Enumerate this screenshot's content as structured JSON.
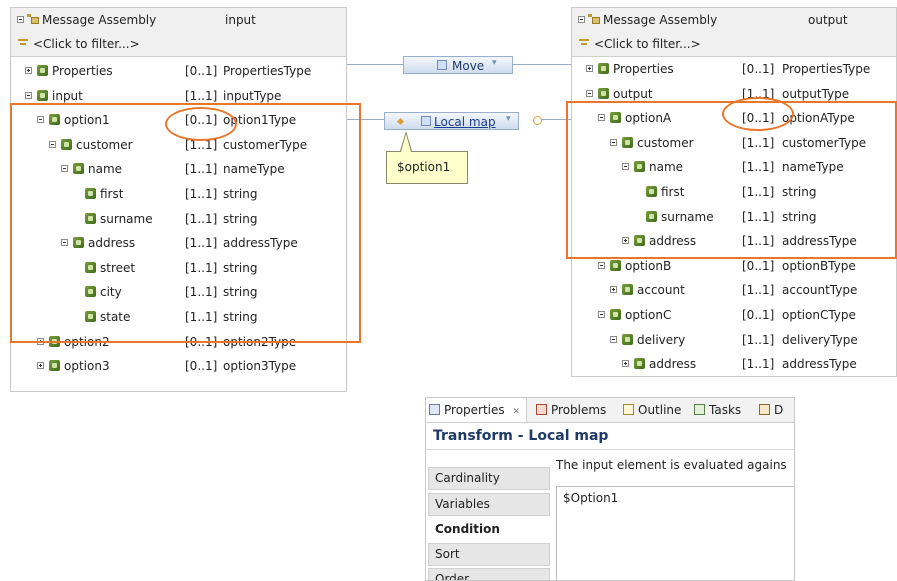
{
  "input_panel": {
    "header": {
      "title": "Message Assembly",
      "type": "input",
      "filter": "<Click to filter...>"
    },
    "rows": [
      {
        "name": "Properties",
        "card": "[0..1]",
        "type": "PropertiesType",
        "expander": "plus",
        "icon": "element"
      },
      {
        "name": "input",
        "card": "[1..1]",
        "type": "inputType",
        "expander": "minus",
        "icon": "element"
      },
      {
        "name": "option1",
        "card": "[0..1]",
        "type": "option1Type",
        "expander": "minus",
        "icon": "element"
      },
      {
        "name": "customer",
        "card": "[1..1]",
        "type": "customerType",
        "expander": "minus",
        "icon": "element"
      },
      {
        "name": "name",
        "card": "[1..1]",
        "type": "nameType",
        "expander": "minus",
        "icon": "element"
      },
      {
        "name": "first",
        "card": "[1..1]",
        "type": "string",
        "expander": "",
        "icon": "element"
      },
      {
        "name": "surname",
        "card": "[1..1]",
        "type": "string",
        "expander": "",
        "icon": "element"
      },
      {
        "name": "address",
        "card": "[1..1]",
        "type": "addressType",
        "expander": "minus",
        "icon": "element"
      },
      {
        "name": "street",
        "card": "[1..1]",
        "type": "string",
        "expander": "",
        "icon": "element"
      },
      {
        "name": "city",
        "card": "[1..1]",
        "type": "string",
        "expander": "",
        "icon": "element"
      },
      {
        "name": "state",
        "card": "[1..1]",
        "type": "string",
        "expander": "",
        "icon": "element"
      },
      {
        "name": "option2",
        "card": "[0..1]",
        "type": "option2Type",
        "expander": "plus",
        "icon": "element"
      },
      {
        "name": "option3",
        "card": "[0..1]",
        "type": "option3Type",
        "expander": "plus",
        "icon": "element"
      }
    ]
  },
  "output_panel": {
    "header": {
      "title": "Message Assembly",
      "type": "output",
      "filter": "<Click to filter...>"
    },
    "rows": [
      {
        "name": "Properties",
        "card": "[0..1]",
        "type": "PropertiesType",
        "expander": "plus"
      },
      {
        "name": "output",
        "card": "[1..1]",
        "type": "outputType",
        "expander": "minus"
      },
      {
        "name": "optionA",
        "card": "[0..1]",
        "type": "optionAType",
        "expander": "minus"
      },
      {
        "name": "customer",
        "card": "[1..1]",
        "type": "customerType",
        "expander": "minus"
      },
      {
        "name": "name",
        "card": "[1..1]",
        "type": "nameType",
        "expander": "minus"
      },
      {
        "name": "first",
        "card": "[1..1]",
        "type": "string",
        "expander": ""
      },
      {
        "name": "surname",
        "card": "[1..1]",
        "type": "string",
        "expander": ""
      },
      {
        "name": "address",
        "card": "[1..1]",
        "type": "addressType",
        "expander": "plus"
      },
      {
        "name": "optionB",
        "card": "[0..1]",
        "type": "optionBType",
        "expander": "minus"
      },
      {
        "name": "account",
        "card": "[1..1]",
        "type": "accountType",
        "expander": "plus"
      },
      {
        "name": "optionC",
        "card": "[0..1]",
        "type": "optionCType",
        "expander": "minus"
      },
      {
        "name": "delivery",
        "card": "[1..1]",
        "type": "deliveryType",
        "expander": "minus"
      },
      {
        "name": "address",
        "card": "[1..1]",
        "type": "addressType",
        "expander": "plus"
      }
    ]
  },
  "transforms": {
    "move": "Move",
    "local_map": "Local map",
    "tooltip": "$option1"
  },
  "properties_view": {
    "tabs": [
      {
        "label": "Properties",
        "close": "✕"
      },
      {
        "label": "Problems"
      },
      {
        "label": "Outline"
      },
      {
        "label": "Tasks"
      },
      {
        "label": "D"
      }
    ],
    "title": "Transform - Local map",
    "sections": [
      "Cardinality",
      "Variables",
      "Condition",
      "Sort",
      "Order"
    ],
    "active_section": "Condition",
    "description": "The input element is evaluated agains",
    "condition_value": "$Option1"
  },
  "colors": {
    "highlight": "#e8772b",
    "link": "#1a3d8f",
    "header_bg": "#f0f0f0"
  }
}
